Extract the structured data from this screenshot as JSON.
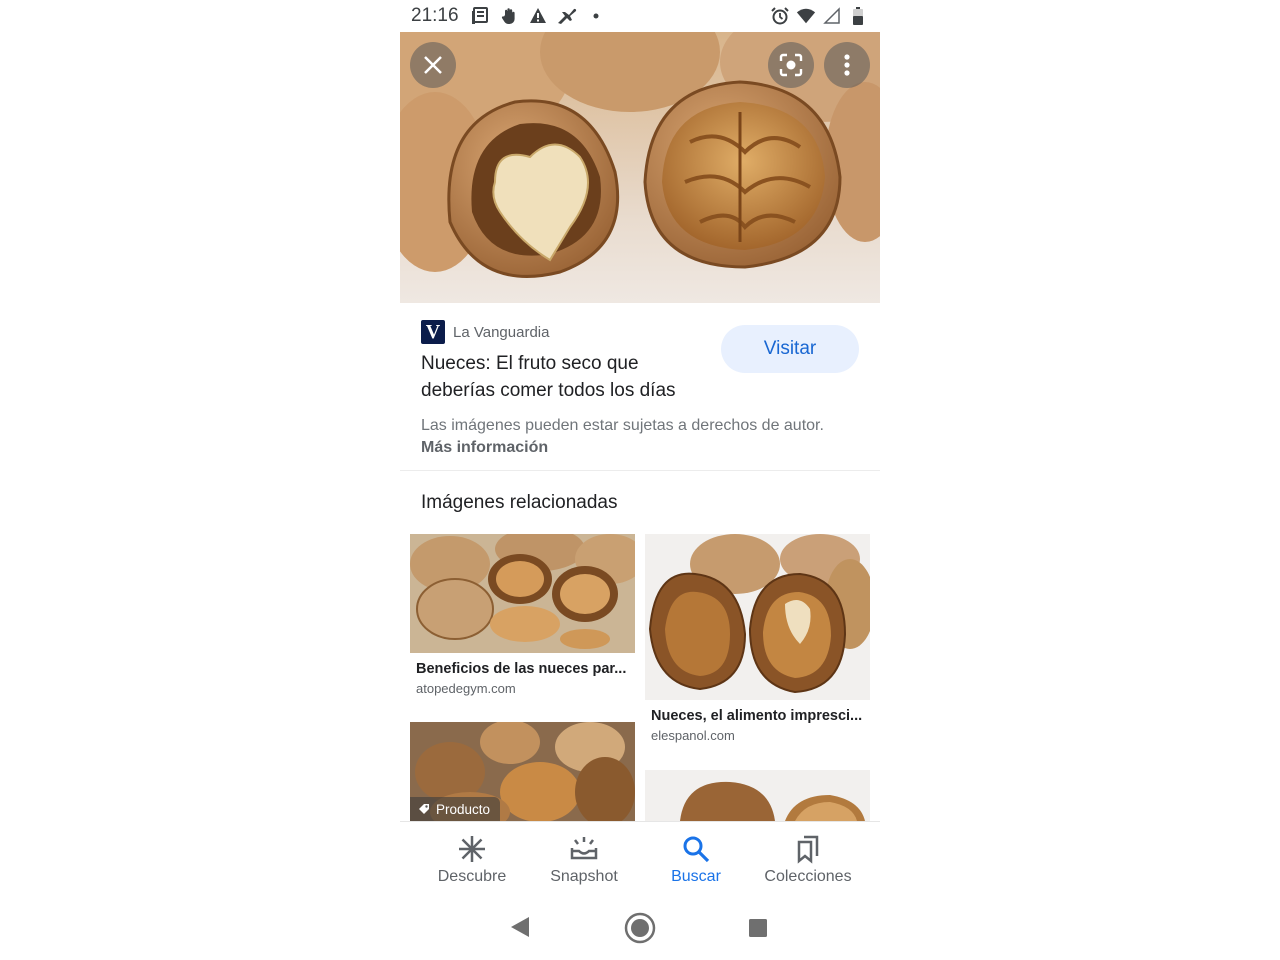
{
  "status_bar": {
    "time": "21:16"
  },
  "hero": {
    "close_icon": "close-icon",
    "lens_icon": "lens-icon",
    "more_icon": "more-vert-icon"
  },
  "result": {
    "source": "La Vanguardia",
    "source_logo_letter": "V",
    "title": "Nueces: El fruto seco que deberías comer todos los días",
    "visit_label": "Visitar",
    "copyright_text": "Las imágenes pueden estar sujetas a derechos de autor.",
    "more_info": "Más información"
  },
  "related": {
    "heading": "Imágenes relacionadas",
    "items": [
      {
        "title": "Beneficios de las nueces par...",
        "domain": "atopedegym.com"
      },
      {
        "title": "Nueces, el alimento impresci...",
        "domain": "elespanol.com"
      },
      {
        "badge": "Producto"
      }
    ]
  },
  "bottom_nav": {
    "items": [
      {
        "label": "Descubre",
        "icon": "asterisk-icon"
      },
      {
        "label": "Snapshot",
        "icon": "snapshot-icon"
      },
      {
        "label": "Buscar",
        "icon": "search-icon"
      },
      {
        "label": "Colecciones",
        "icon": "collections-icon"
      }
    ],
    "active": "Buscar"
  },
  "colors": {
    "accent": "#1a73e8",
    "visit_bg": "#e8f0fe",
    "text": "#202124",
    "muted": "#5f6368"
  }
}
